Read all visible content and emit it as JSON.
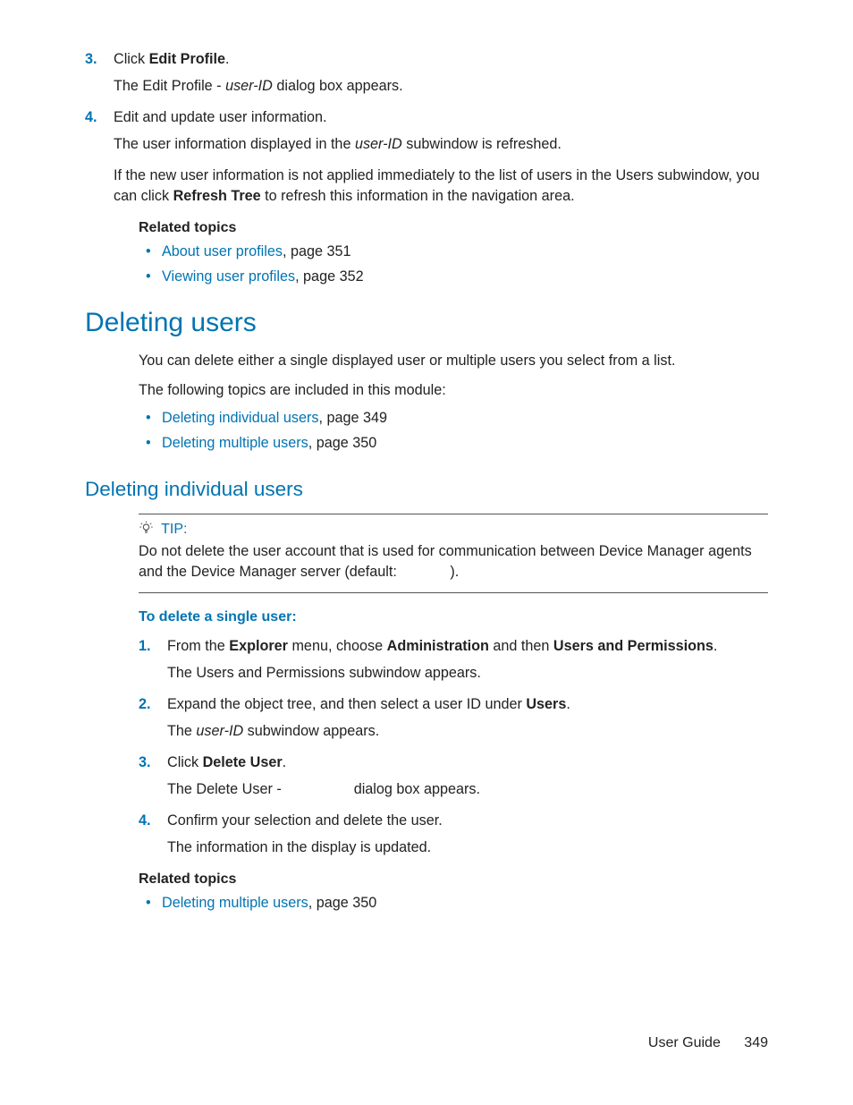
{
  "steps_top": [
    {
      "num": "3.",
      "line1_pre": "Click ",
      "line1_bold": "Edit Profile",
      "line1_post": ".",
      "line2_pre": "The Edit Profile - ",
      "line2_italic": "user-ID",
      "line2_post": " dialog box appears."
    },
    {
      "num": "4.",
      "line1": "Edit and update user information.",
      "line2_pre": "The user information displayed in the ",
      "line2_italic": "user-ID",
      "line2_post": " subwindow is refreshed.",
      "line3_pre": "If the new user information is not applied immediately to the list of users in the Users subwindow, you can click ",
      "line3_bold": "Refresh Tree",
      "line3_post": " to refresh this information in the navigation area."
    }
  ],
  "related1": {
    "heading": "Related topics",
    "items": [
      {
        "link": "About user profiles",
        "suffix": ", page 351"
      },
      {
        "link": "Viewing user profiles",
        "suffix": ", page 352"
      }
    ]
  },
  "section_heading": "Deleting users",
  "section_intro1": "You can delete either a single displayed user or multiple users you select from a list.",
  "section_intro2": "The following topics are included in this module:",
  "section_toc": [
    {
      "link": "Deleting individual users",
      "suffix": ", page 349"
    },
    {
      "link": "Deleting multiple users",
      "suffix": ", page 350"
    }
  ],
  "sub_heading": "Deleting individual users",
  "tip": {
    "label": "TIP:",
    "body_pre": "Do not delete the user account that is used for communication between Device Manager agents and the Device Manager server (default: ",
    "body_post": ")."
  },
  "proc_title": "To delete a single user:",
  "steps_delete": [
    {
      "num": "1.",
      "line1_parts": {
        "t0": "From the ",
        "b0": "Explorer",
        "t1": " menu, choose ",
        "b1": "Administration",
        "t2": " and then ",
        "b2": "Users and Permissions",
        "t3": "."
      },
      "line2": "The Users and Permissions subwindow appears."
    },
    {
      "num": "2.",
      "line1_parts": {
        "t0": "Expand the object tree, and then select a user ID under ",
        "b0": "Users",
        "t1": "."
      },
      "line2_pre": "The ",
      "line2_italic": "user-ID",
      "line2_post": " subwindow appears."
    },
    {
      "num": "3.",
      "line1_parts": {
        "t0": "Click ",
        "b0": "Delete User",
        "t1": "."
      },
      "line2_plain": "The Delete User -                  dialog box appears."
    },
    {
      "num": "4.",
      "line1_plain": "Confirm your selection and delete the user.",
      "line2": "The information in the display is updated."
    }
  ],
  "related2": {
    "heading": "Related topics",
    "items": [
      {
        "link": "Deleting multiple users",
        "suffix": ", page 350"
      }
    ]
  },
  "footer": {
    "label": "User Guide",
    "page": "349"
  }
}
